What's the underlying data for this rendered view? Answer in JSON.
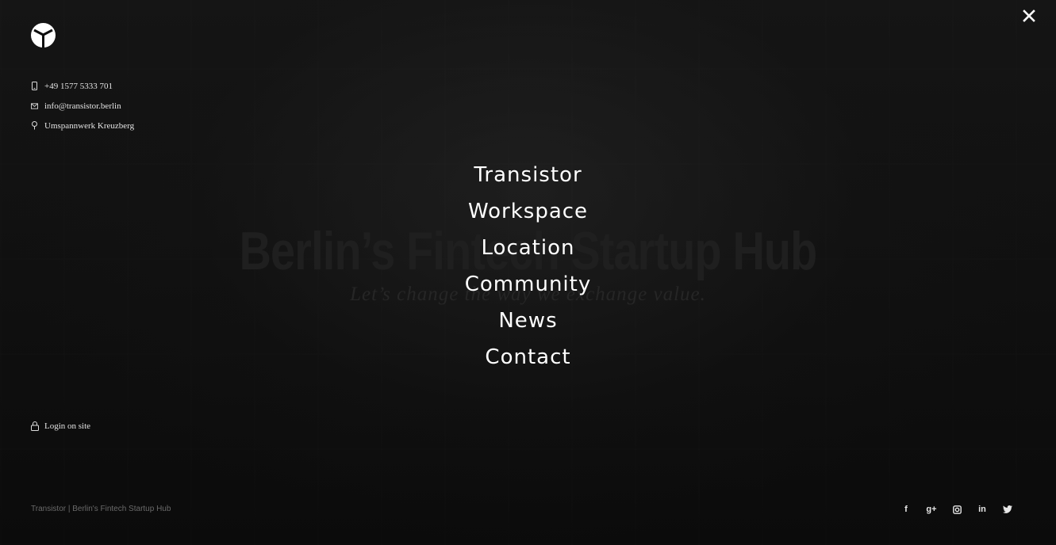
{
  "hero": {
    "title": "Berlin’s Fintech Startup Hub",
    "subtitle": "Let’s change the way we exchange value."
  },
  "brand": {
    "logo_icon": "transistor-logo-icon"
  },
  "contact": {
    "phone": "+49 1577 5333 701",
    "email": "info@transistor.berlin",
    "address": "Umspannwerk Kreuzberg"
  },
  "menu": {
    "items": [
      {
        "label": "Transistor"
      },
      {
        "label": "Workspace"
      },
      {
        "label": "Location"
      },
      {
        "label": "Community"
      },
      {
        "label": "News"
      },
      {
        "label": "Contact"
      }
    ],
    "close_icon": "close-icon"
  },
  "login": {
    "label": "Login on site",
    "icon": "lock-icon"
  },
  "footer": {
    "text": "Transistor | Berlin's Fintech Startup Hub"
  },
  "social": {
    "items": [
      {
        "name": "facebook",
        "glyph": "f"
      },
      {
        "name": "google-plus",
        "glyph": "g+"
      },
      {
        "name": "instagram",
        "glyph": ""
      },
      {
        "name": "linkedin",
        "glyph": "in"
      },
      {
        "name": "twitter",
        "glyph": ""
      }
    ]
  },
  "colors": {
    "background": "#0e0e0e",
    "text": "#ffffff",
    "muted": "#6a6a6a"
  }
}
